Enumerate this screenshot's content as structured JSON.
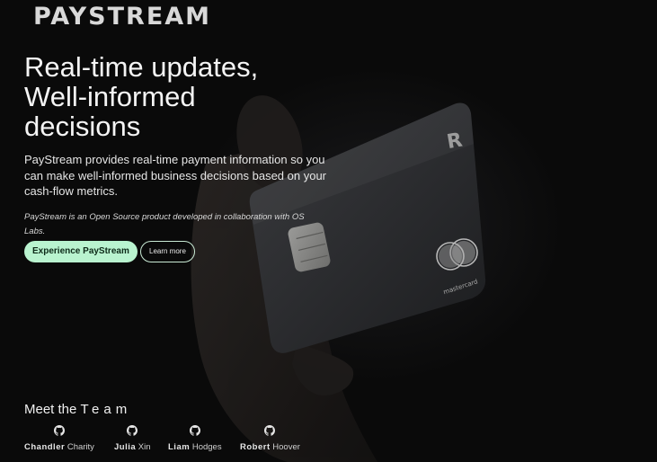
{
  "brand": {
    "logo_text": "PAYSTREAM"
  },
  "hero": {
    "headline_line1": "Real-time updates,",
    "headline_line2": "Well-informed",
    "headline_line3": "decisions",
    "lede": "PayStream provides real-time payment information so you can make well-informed business decisions based on your cash-flow metrics.",
    "note": "PayStream is an Open Source product developed in collaboration with OS Labs.",
    "primary_button": "Experience PayStream",
    "secondary_button": "Learn more"
  },
  "card": {
    "issuer_mark": "R",
    "network_label": "mastercard"
  },
  "team": {
    "title_start": "Meet the ",
    "title_spaced": "Team",
    "members": [
      {
        "first": "Chandler",
        "last": "Charity",
        "icon": "github-icon"
      },
      {
        "first": "Julia",
        "last": "Xin",
        "icon": "github-icon"
      },
      {
        "first": "Liam",
        "last": "Hodges",
        "icon": "github-icon"
      },
      {
        "first": "Robert",
        "last": "Hoover",
        "icon": "github-icon"
      }
    ]
  },
  "colors": {
    "background": "#0a0a0a",
    "accent_green": "#b9f3cf",
    "text": "#f2f2f2"
  }
}
